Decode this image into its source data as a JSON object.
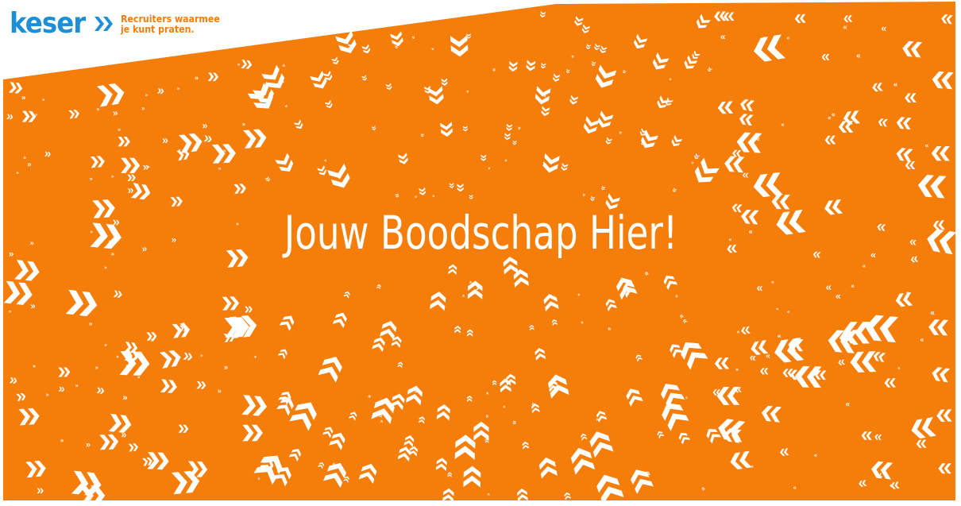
{
  "logo": {
    "word": "keser",
    "tagline_line1": "Recruiters waarmee",
    "tagline_line2": "je kunt praten.",
    "word_color": "#1e8fd6",
    "chevron_color": "#1e8fd6",
    "tagline_color": "#f57e0a",
    "chevron_icon": "double-chevron-right-icon"
  },
  "banner": {
    "background_color": "#f57e0a",
    "pattern_color": "#ffffff",
    "pattern_icons": [
      "chevron-right-icon",
      "chevron-left-icon",
      "chevron-up-icon",
      "chevron-down-icon"
    ]
  },
  "headline": {
    "text": "Jouw Boodschap Hier!"
  }
}
